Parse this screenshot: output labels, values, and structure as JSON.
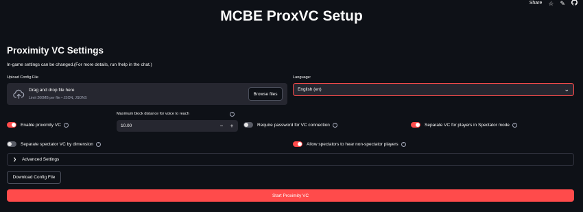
{
  "toolbar": {
    "share_label": "Share",
    "icons": [
      "star-icon",
      "edit-icon",
      "github-icon"
    ]
  },
  "app_title": "MCBE ProxVC Setup",
  "section": {
    "title": "Proximity VC Settings",
    "caption": "In-game settings can be changed.(For more details, run !help in the chat.)"
  },
  "uploader": {
    "label": "Upload Config File",
    "drop_text": "Drag and drop file here",
    "limit_text": "Limit 200MB per file • JSON, JSONS",
    "browse_label": "Browse files"
  },
  "language": {
    "label": "Language:",
    "value": "English (en)"
  },
  "settings": {
    "enable_proximity": {
      "label": "Enable proximity VC",
      "on": true
    },
    "max_distance": {
      "label": "Maximum block distance for voice to reach",
      "value": "10.00",
      "minus": "−",
      "plus": "+"
    },
    "require_password": {
      "label": "Require password for VC connection",
      "on": false
    },
    "separate_spectator": {
      "label": "Separate VC for players in Spectator mode",
      "on": true
    },
    "separate_dimension": {
      "label": "Separate spectator VC by dimension",
      "on": false
    },
    "allow_spectators": {
      "label": "Allow spectators to hear non-spectator players",
      "on": true
    }
  },
  "help_glyph": "?",
  "advanced": {
    "label": "Advanced Settings"
  },
  "download_label": "Download Config File",
  "start_label": "Start Proximity VC",
  "colors": {
    "background": "#0e1117",
    "accent": "#ff4b4b",
    "widget_bg": "#262730"
  }
}
